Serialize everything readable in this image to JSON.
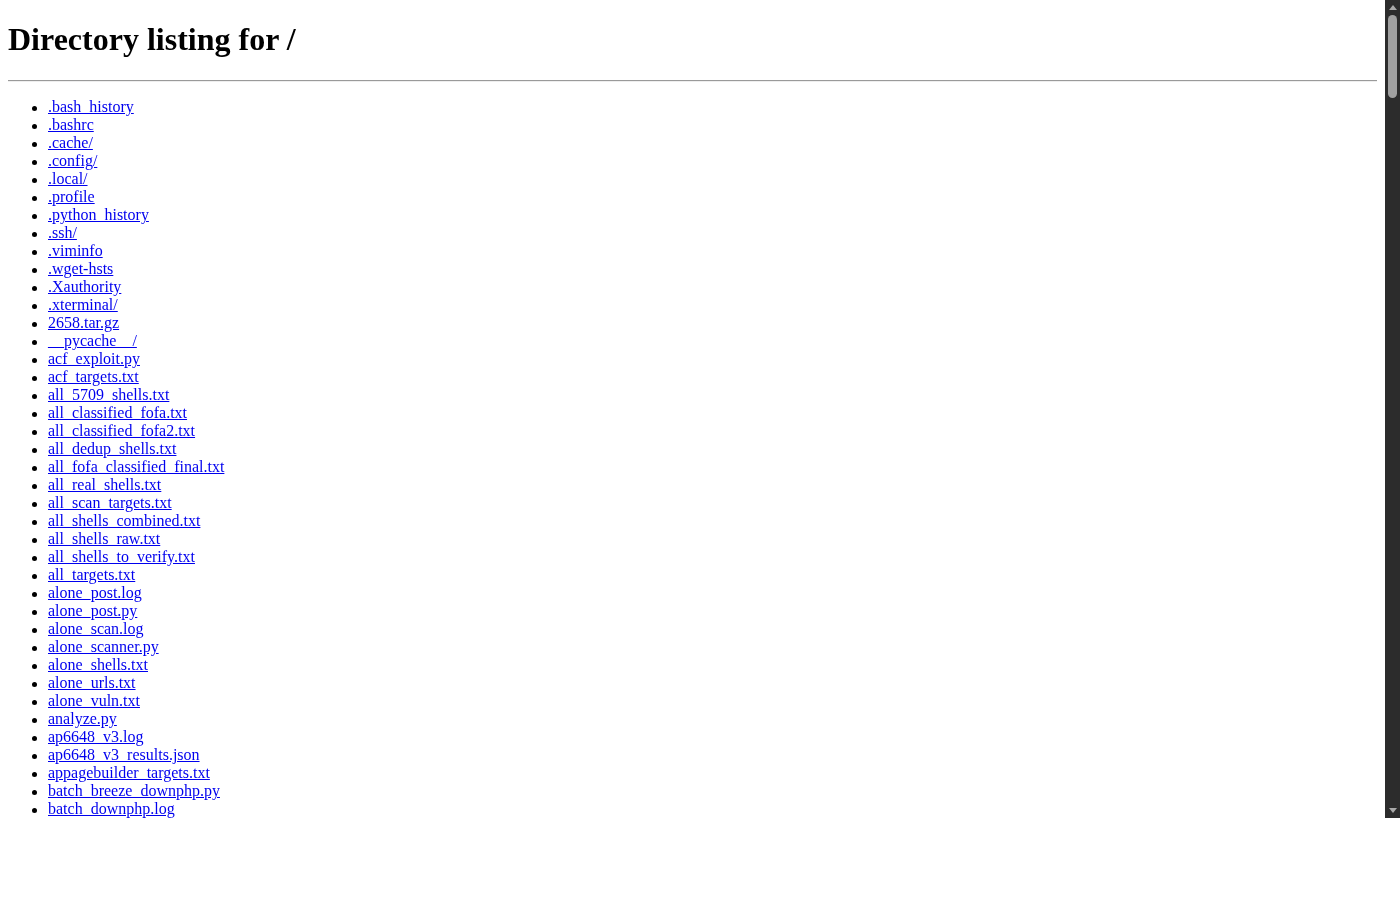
{
  "heading": "Directory listing for /",
  "entries": [
    ".bash_history",
    ".bashrc",
    ".cache/",
    ".config/",
    ".local/",
    ".profile",
    ".python_history",
    ".ssh/",
    ".viminfo",
    ".wget-hsts",
    ".Xauthority",
    ".xterminal/",
    "2658.tar.gz",
    "__pycache__/",
    "acf_exploit.py",
    "acf_targets.txt",
    "all_5709_shells.txt",
    "all_classified_fofa.txt",
    "all_classified_fofa2.txt",
    "all_dedup_shells.txt",
    "all_fofa_classified_final.txt",
    "all_real_shells.txt",
    "all_scan_targets.txt",
    "all_shells_combined.txt",
    "all_shells_raw.txt",
    "all_shells_to_verify.txt",
    "all_targets.txt",
    "alone_post.log",
    "alone_post.py",
    "alone_scan.log",
    "alone_scanner.py",
    "alone_shells.txt",
    "alone_urls.txt",
    "alone_vuln.txt",
    "analyze.py",
    "ap6648_v3.log",
    "ap6648_v3_results.json",
    "appagebuilder_targets.txt",
    "batch_breeze_downphp.py",
    "batch_downphp.log"
  ]
}
